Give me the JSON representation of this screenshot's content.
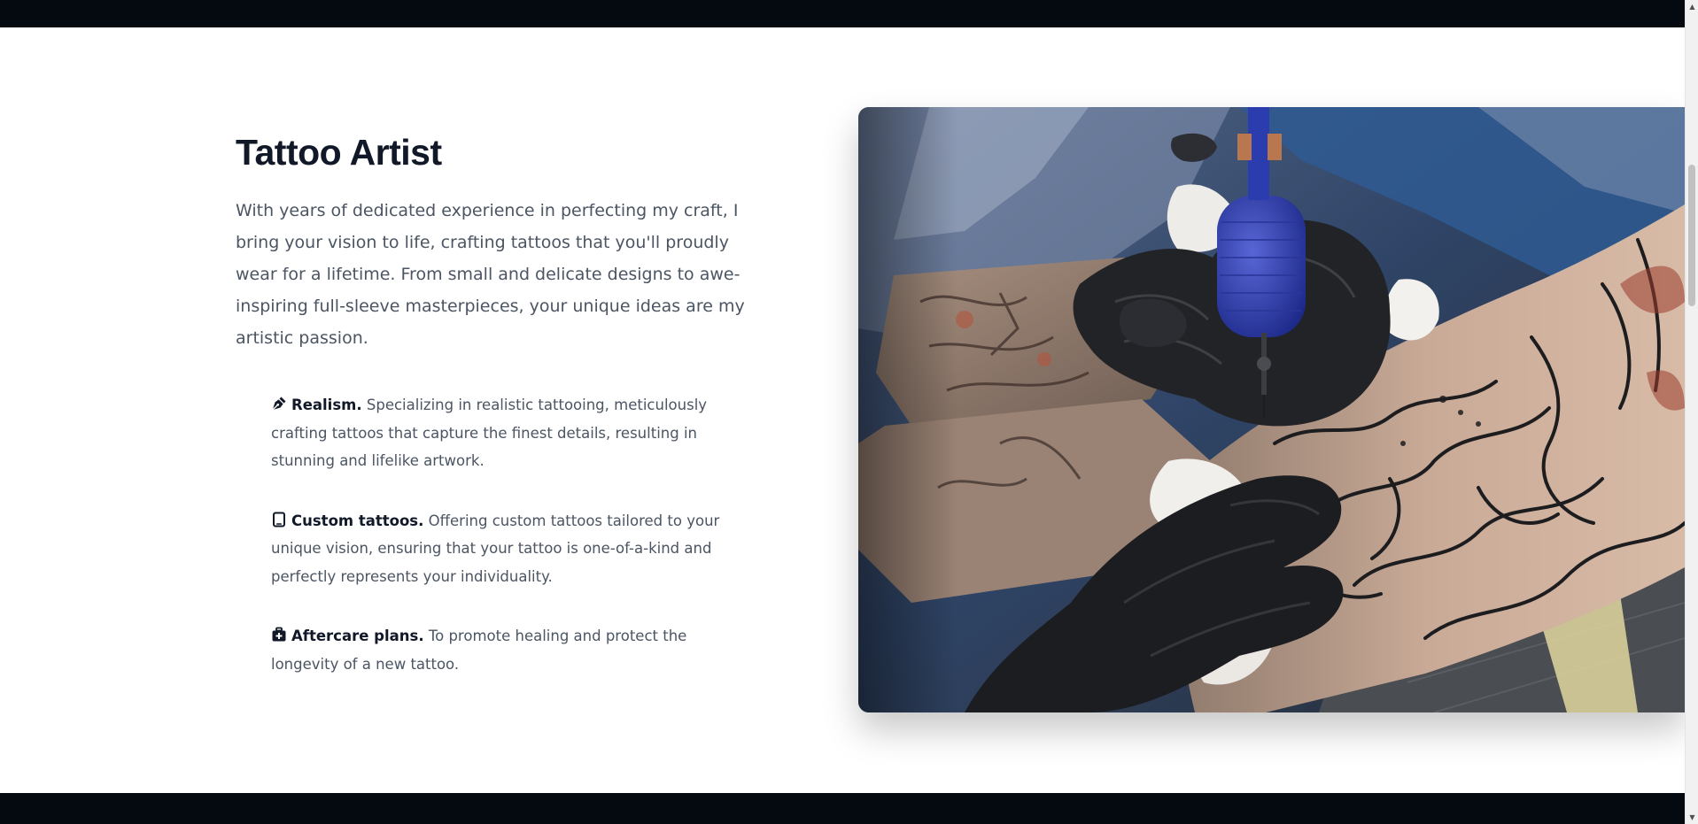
{
  "section": {
    "title": "Tattoo Artist",
    "lead": "With years of dedicated experience in perfecting my craft, I bring your vision to life, crafting tattoos that you'll proudly wear for a lifetime. From small and delicate designs to awe-inspiring full-sleeve masterpieces, your unique ideas are my artistic passion."
  },
  "features": [
    {
      "icon": "pen-nib-icon",
      "name": "Realism.",
      "description": "Specializing in realistic tattooing, meticulously crafting tattoos that capture the finest details, resulting in stunning and lifelike artwork."
    },
    {
      "icon": "tablet-icon",
      "name": "Custom tattoos.",
      "description": "Offering custom tattoos tailored to your unique vision, ensuring that your tattoo is one-of-a-kind and perfectly represents your individuality."
    },
    {
      "icon": "medical-kit-icon",
      "name": "Aftercare plans.",
      "description": "To promote healing and protect the longevity of a new tattoo."
    }
  ],
  "image": {
    "subject": "tattoo-artist-at-work-photo"
  },
  "colors": {
    "heading": "#111827",
    "body_text": "#4b5563",
    "dark_band": "#050a10",
    "background": "#ffffff"
  }
}
